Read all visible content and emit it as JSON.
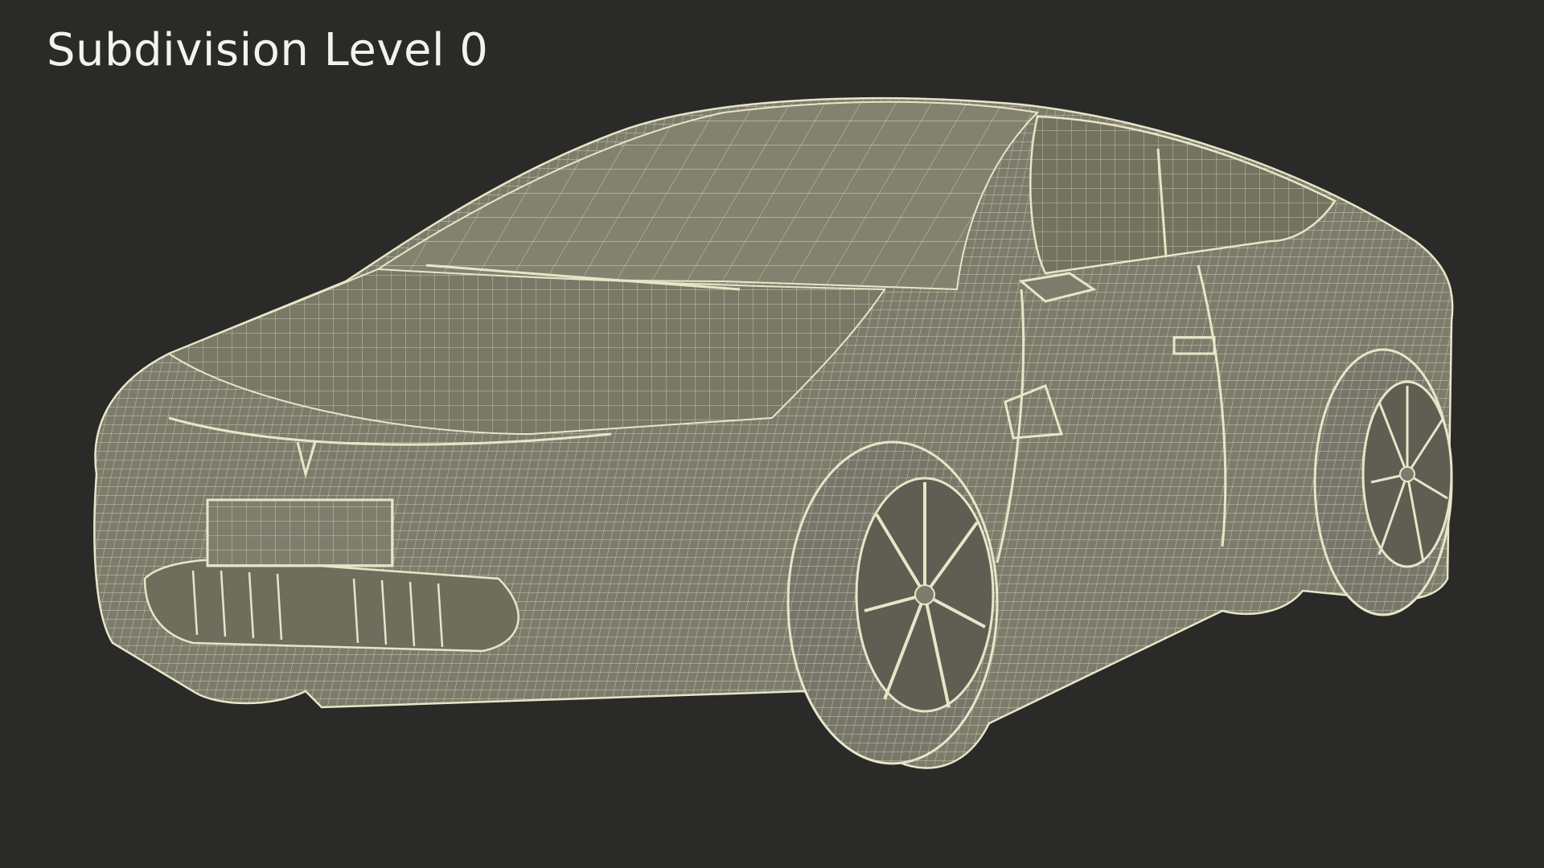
{
  "caption": "Subdivision Level 0",
  "colors": {
    "background": "#2a2a28",
    "body_fill": "#7d7c6c",
    "wire": "#e8e6c8",
    "caption_text": "#f2f2ee"
  },
  "subject": "wireframe-car-model-icon"
}
